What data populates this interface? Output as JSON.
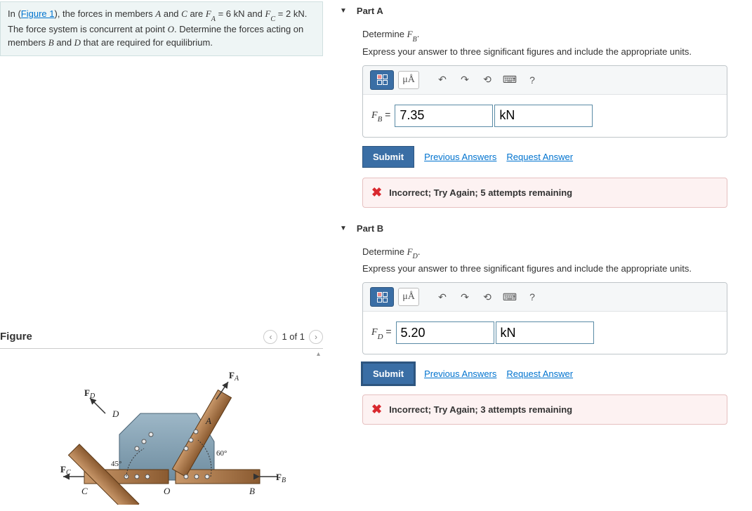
{
  "prompt": {
    "pre": "In (",
    "fig_link": "Figure 1",
    "mid1": "), the forces in members ",
    "A": "A",
    "mid2": " and ",
    "C": "C",
    "mid3": " are ",
    "FA_lbl": "F",
    "FA_sub": "A",
    "eq1": " = 6 kN and ",
    "FC_lbl": "F",
    "FC_sub": "C",
    "eq2": " = 2 kN. The force system is concurrent at point ",
    "O": "O",
    "mid4": ". Determine the forces acting on members ",
    "B": "B",
    "mid5": " and ",
    "D": "D",
    "mid6": " that are required for equilibrium."
  },
  "figure": {
    "title": "Figure",
    "counter": "1 of 1",
    "labels": {
      "FA": "F",
      "FA_sub": "A",
      "FB": "F",
      "FB_sub": "B",
      "FC": "F",
      "FC_sub": "C",
      "FD": "F",
      "FD_sub": "D",
      "A": "A",
      "B": "B",
      "C": "C",
      "D": "D",
      "O": "O",
      "ang45": "45°",
      "ang60": "60°"
    }
  },
  "parts": {
    "A": {
      "title": "Part A",
      "determine_pre": "Determine ",
      "var": "F",
      "var_sub": "B",
      "determine_post": ".",
      "instruction": "Express your answer to three significant figures and include the appropriate units.",
      "toolbar": {
        "mu": "μÅ",
        "help": "?"
      },
      "eq_lbl": "F",
      "eq_sub": "B",
      "eq_equals": " = ",
      "value": "7.35",
      "unit": "kN",
      "submit": "Submit",
      "prev": "Previous Answers",
      "req": "Request Answer",
      "feedback": "Incorrect; Try Again; 5 attempts remaining"
    },
    "B": {
      "title": "Part B",
      "determine_pre": "Determine ",
      "var": "F",
      "var_sub": "D",
      "determine_post": ".",
      "instruction": "Express your answer to three significant figures and include the appropriate units.",
      "toolbar": {
        "mu": "μÅ",
        "help": "?"
      },
      "eq_lbl": "F",
      "eq_sub": "D",
      "eq_equals": " = ",
      "value": "5.20",
      "unit": "kN",
      "submit": "Submit",
      "prev": "Previous Answers",
      "req": "Request Answer",
      "feedback": "Incorrect; Try Again; 3 attempts remaining"
    }
  }
}
